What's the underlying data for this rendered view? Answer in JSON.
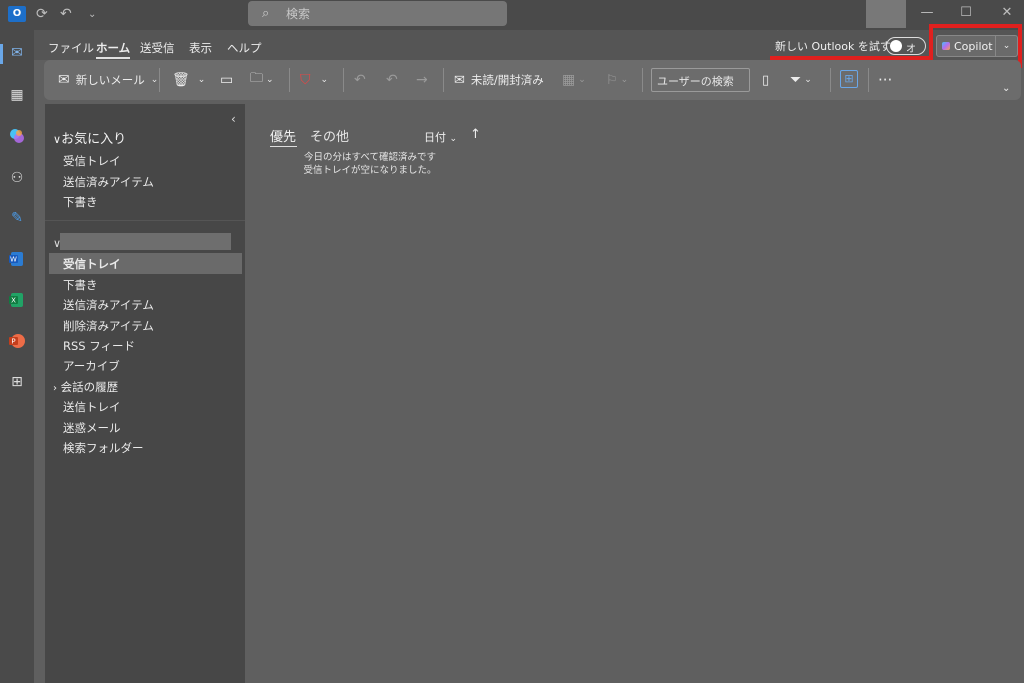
{
  "titlebar": {
    "search_placeholder": "検索"
  },
  "menu": {
    "tabs": [
      "ファイル",
      "ホーム",
      "送受信",
      "表示",
      "ヘルプ"
    ],
    "active": "ホーム",
    "new_outlook_label": "新しい Outlook を試す",
    "toggle_label": "オフ",
    "copilot_label": "Copilot"
  },
  "ribbon": {
    "new_mail": "新しいメール",
    "unread_read": "未読/開封済み",
    "user_search": "ユーザーの検索"
  },
  "folders": {
    "favorites_title": "お気に入り",
    "favorites": [
      "受信トレイ",
      "送信済みアイテム",
      "下書き"
    ],
    "account_items": [
      "受信トレイ",
      "下書き",
      "送信済みアイテム",
      "削除済みアイテム",
      "RSS フィード",
      "アーカイブ",
      "会話の履歴",
      "送信トレイ",
      "迷惑メール",
      "検索フォルダー"
    ],
    "selected": "受信トレイ"
  },
  "message_list": {
    "tab_priority": "優先",
    "tab_other": "その他",
    "sort_label": "日付",
    "empty_line1": "今日の分はすべて確認済みです",
    "empty_line2": "受信トレイが空になりました。"
  },
  "colors": {
    "highlight_red": "#e0201e",
    "accent_blue": "#6aa7e8"
  }
}
